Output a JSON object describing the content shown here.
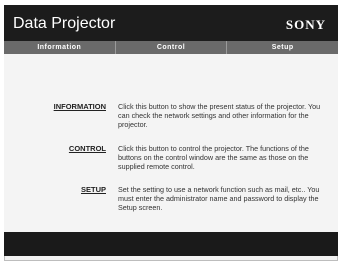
{
  "header": {
    "title": "Data Projector",
    "brand": "SONY"
  },
  "tabs": [
    {
      "label": "Information"
    },
    {
      "label": "Control"
    },
    {
      "label": "Setup"
    }
  ],
  "items": [
    {
      "link": "INFORMATION",
      "description": "Click this button to show the present status of the projector. You can check the network settings and other information for the projector."
    },
    {
      "link": "CONTROL",
      "description": "Click this button to control the projector. The functions of the buttons on the control window are the same as those on the supplied remote control."
    },
    {
      "link": "SETUP",
      "description": "Set the setting to use a network function such as mail, etc.. You must enter the administrator name and password to display the Setup screen."
    }
  ],
  "colors": {
    "header_bg": "#1c1c1c",
    "tab_bg": "#6a6a6a",
    "content_bg": "#f4f4f4",
    "footer_bg": "#1a1a1a"
  }
}
